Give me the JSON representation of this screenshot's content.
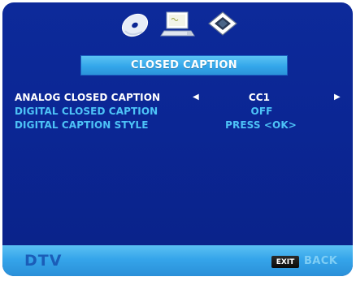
{
  "tabs": [
    {
      "icon": "disc-icon"
    },
    {
      "icon": "computer-icon"
    },
    {
      "icon": "monitor-icon"
    }
  ],
  "title": "CLOSED CAPTION",
  "menu": {
    "items": [
      {
        "label": "ANALOG CLOSED CAPTION",
        "value": "CC1",
        "selected": true
      },
      {
        "label": "DIGITAL CLOSED CAPTION",
        "value": "OFF",
        "selected": false
      },
      {
        "label": "DIGITAL CAPTION STYLE",
        "value": "PRESS <OK>",
        "selected": false
      }
    ],
    "arrow_left": "◀",
    "arrow_right": "▶"
  },
  "footer": {
    "mode": "DTV",
    "exit_key": "EXIT",
    "back_label": "BACK"
  },
  "colors": {
    "background": "#0b2694",
    "accent": "#33a6ea",
    "selected_text": "#ffffff",
    "normal_text": "#4dc3f7"
  }
}
